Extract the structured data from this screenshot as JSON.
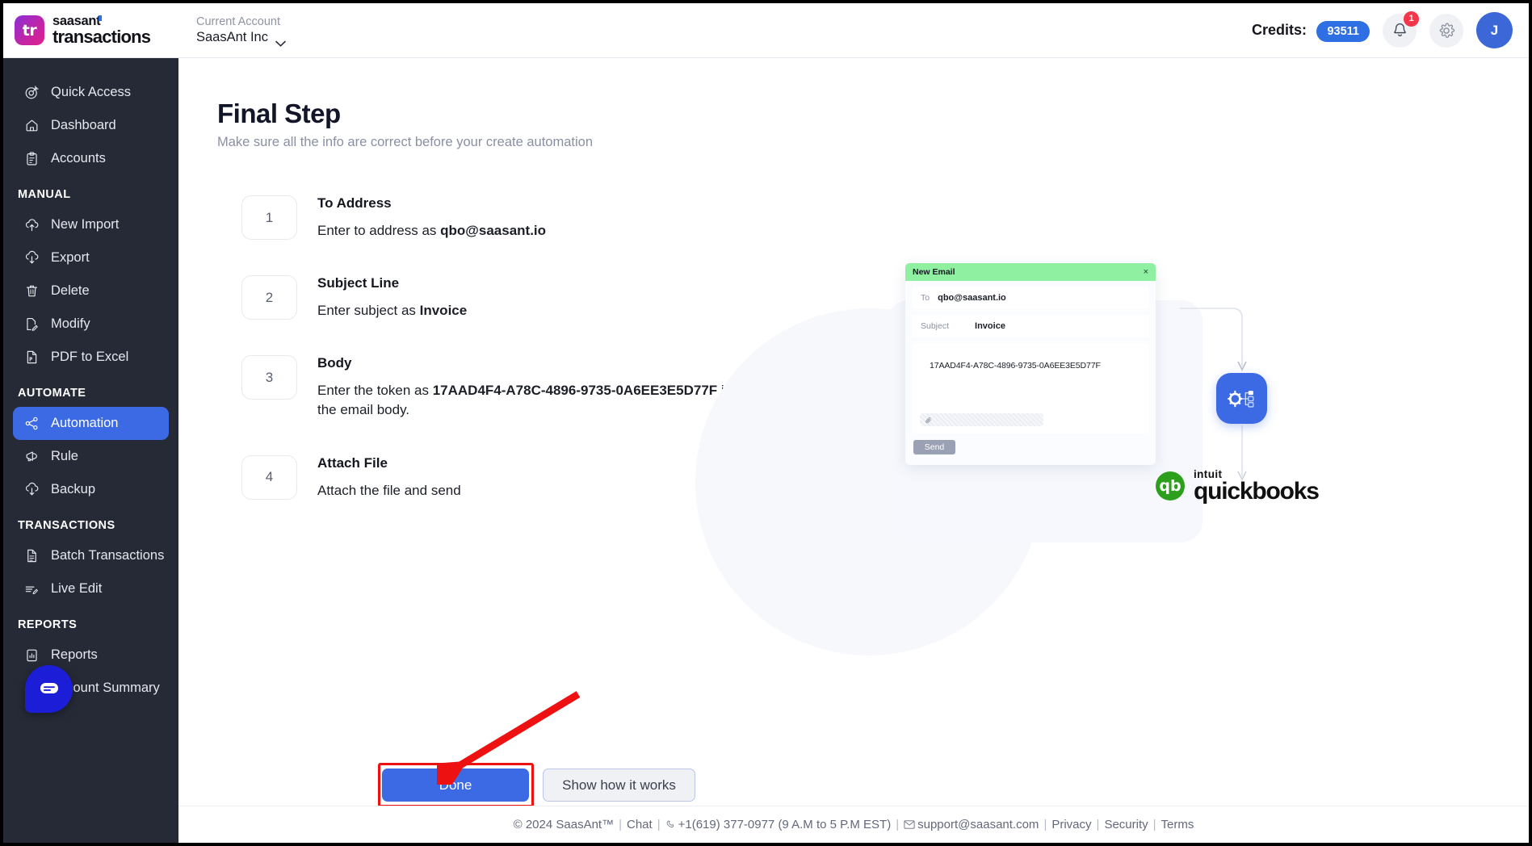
{
  "header": {
    "brand_top": "saasant",
    "brand_bottom": "transactions",
    "brand_logo_text": "tr",
    "account_label": "Current Account",
    "account_value": "SaasAnt Inc",
    "credits_label": "Credits:",
    "credits_value": "93511",
    "notification_count": "1",
    "avatar_initial": "J",
    "accent_color": "#3c6ae4"
  },
  "sidebar": {
    "items": [
      {
        "label": "Quick Access",
        "icon": "target-icon",
        "active": false
      },
      {
        "label": "Dashboard",
        "icon": "home-icon",
        "active": false
      },
      {
        "label": "Accounts",
        "icon": "clipboard-icon",
        "active": false
      }
    ],
    "sections": [
      {
        "title": "MANUAL",
        "items": [
          {
            "label": "New Import",
            "icon": "cloud-upload-icon",
            "active": false
          },
          {
            "label": "Export",
            "icon": "cloud-download-icon",
            "active": false
          },
          {
            "label": "Delete",
            "icon": "trash-icon",
            "active": false
          },
          {
            "label": "Modify",
            "icon": "file-edit-icon",
            "active": false
          },
          {
            "label": "PDF to Excel",
            "icon": "pdf-file-icon",
            "active": false
          }
        ]
      },
      {
        "title": "AUTOMATE",
        "items": [
          {
            "label": "Automation",
            "icon": "share-nodes-icon",
            "active": true
          },
          {
            "label": "Rule",
            "icon": "megaphone-icon",
            "active": false
          },
          {
            "label": "Backup",
            "icon": "cloud-download-icon",
            "active": false
          }
        ]
      },
      {
        "title": "TRANSACTIONS",
        "items": [
          {
            "label": "Batch Transactions",
            "icon": "document-icon",
            "active": false
          },
          {
            "label": "Live Edit",
            "icon": "list-edit-icon",
            "active": false
          }
        ]
      },
      {
        "title": "REPORTS",
        "items": [
          {
            "label": "Reports",
            "icon": "chart-icon",
            "active": false
          },
          {
            "label": "Account Summary",
            "icon": "clipboard-icon",
            "active": false
          }
        ]
      }
    ]
  },
  "main": {
    "title": "Final Step",
    "subtitle": "Make sure all the info are correct before your create automation",
    "steps": [
      {
        "number": "1",
        "title": "To Address",
        "desc_prefix": "Enter to address as ",
        "desc_bold": "qbo@saasant.io",
        "desc_suffix": ""
      },
      {
        "number": "2",
        "title": "Subject Line",
        "desc_prefix": "Enter subject as ",
        "desc_bold": "Invoice",
        "desc_suffix": ""
      },
      {
        "number": "3",
        "title": "Body",
        "desc_prefix": "Enter the token as ",
        "desc_bold": "17AAD4F4-A78C-4896-9735-0A6EE3E5D77F",
        "desc_suffix": " in the email body."
      },
      {
        "number": "4",
        "title": "Attach File",
        "desc_prefix": "Attach the file and send",
        "desc_bold": "",
        "desc_suffix": ""
      }
    ],
    "done_button": "Done",
    "how_button": "Show how it works"
  },
  "illustration": {
    "mail_title": "New Email",
    "mail_close": "×",
    "to_label": "To",
    "to_value": "qbo@saasant.io",
    "subject_label": "Subject",
    "subject_value": "Invoice",
    "body_token": "17AAD4F4-A78C-4896-9735-0A6EE3E5D77F",
    "send_label": "Send",
    "qb_intuit": "intuit",
    "qb_name": "quickbooks",
    "header_color": "#8ef0a0",
    "node_color": "#3c6ae4",
    "qb_green": "#2ca01c"
  },
  "footer": {
    "copyright": "© 2024 SaasAnt™",
    "chat": "Chat",
    "phone": "+1(619) 377-0977 (9 A.M to 5 P.M EST)",
    "email": "support@saasant.com",
    "privacy": "Privacy",
    "security": "Security",
    "terms": "Terms"
  },
  "annotation": {
    "highlight_color": "#ee1111"
  }
}
